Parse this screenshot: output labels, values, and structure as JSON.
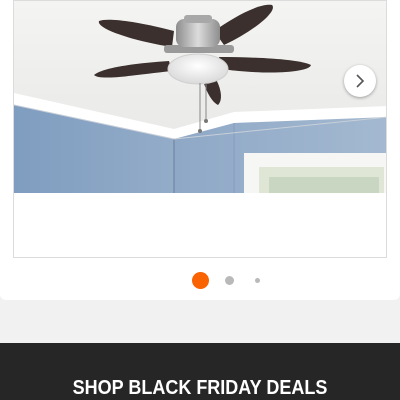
{
  "carousel": {
    "image_alt": "ceiling fan with light kit",
    "next_icon": "chevron-right-icon",
    "slide_count": 3,
    "active_slide": 1,
    "active_color": "#f96302",
    "inactive_color": "#b9b9b9"
  },
  "promo_banner": {
    "label": "SHOP BLACK FRIDAY DEALS",
    "background": "#262626"
  }
}
